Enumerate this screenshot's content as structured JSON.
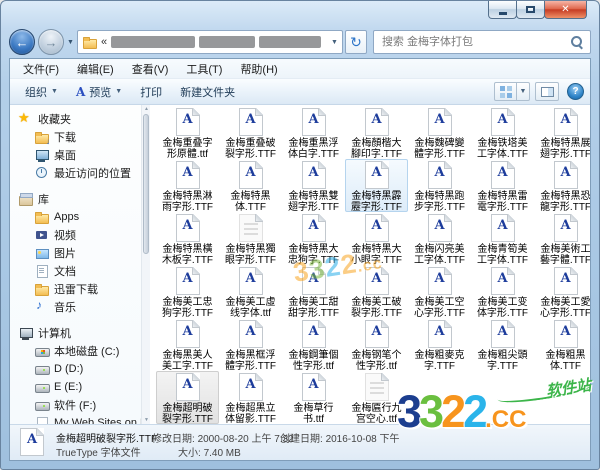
{
  "glyphs": {
    "back": "←",
    "forward": "→",
    "dropdown": "▼",
    "history_dropdown": "▼",
    "refresh": "↻",
    "address_chevron": "«",
    "close": "✕",
    "help": "?",
    "file_letter": "A",
    "scroll_up": "▲",
    "scroll_down": "▼"
  },
  "topbar": {
    "search_text": "搜索 金梅字体打包"
  },
  "menubar": {
    "items": [
      "文件(F)",
      "编辑(E)",
      "查看(V)",
      "工具(T)",
      "帮助(H)"
    ]
  },
  "command_bar": {
    "organize": "组织",
    "preview": "预览",
    "print": "打印",
    "new_folder": "新建文件夹"
  },
  "sidebar": {
    "sections": [
      {
        "label": "收藏夹",
        "icon": "star",
        "items": [
          {
            "label": "下载",
            "icon": "folderdl"
          },
          {
            "label": "桌面",
            "icon": "desktop"
          },
          {
            "label": "最近访问的位置",
            "icon": "recent"
          }
        ]
      },
      {
        "label": "库",
        "icon": "libs",
        "items": [
          {
            "label": "Apps",
            "icon": "folder"
          },
          {
            "label": "视频",
            "icon": "video"
          },
          {
            "label": "图片",
            "icon": "pic"
          },
          {
            "label": "文档",
            "icon": "doc"
          },
          {
            "label": "迅雷下载",
            "icon": "folder"
          },
          {
            "label": "音乐",
            "icon": "music"
          }
        ]
      },
      {
        "label": "计算机",
        "icon": "computer",
        "items": [
          {
            "label": "本地磁盘 (C:)",
            "icon": "drivec"
          },
          {
            "label": "D (D:)",
            "icon": "drive"
          },
          {
            "label": "E (E:)",
            "icon": "drive"
          },
          {
            "label": "软件 (F:)",
            "icon": "drive"
          },
          {
            "label": "My Web Sites on MSN",
            "icon": "page"
          }
        ]
      }
    ]
  },
  "files": [
    {
      "name": "金梅重叠字形原體.ttf",
      "lines": [
        "金梅重叠字",
        "形原體.ttf"
      ]
    },
    {
      "name": "金梅重叠破裂字形.TTF",
      "lines": [
        "金梅重叠破",
        "裂字形.TTF"
      ]
    },
    {
      "name": "金梅重黑浮体白字.TTF",
      "lines": [
        "金梅重黑浮",
        "体白字.TTF"
      ]
    },
    {
      "name": "金梅顏楷大腳印字.TTF",
      "lines": [
        "金梅顏楷大",
        "腳印字.TTF"
      ]
    },
    {
      "name": "金梅魏碑變體字形.TTF",
      "lines": [
        "金梅魏碑變",
        "體字形.TTF"
      ]
    },
    {
      "name": "金梅铁塔美工字体.TTF",
      "lines": [
        "金梅铁塔美",
        "工字体.TTF"
      ]
    },
    {
      "name": "金梅特黑展翅字形.TTF",
      "lines": [
        "金梅特黑展",
        "翅字形.TTF"
      ]
    },
    {
      "name": "金梅特黑淋雨字形.TTF",
      "lines": [
        "金梅特黑淋",
        "雨字形.TTF"
      ]
    },
    {
      "name": "金梅特黑体.TTF",
      "lines": [
        "金梅特黑",
        "体.TTF"
      ]
    },
    {
      "name": "金梅特黑雙翅字形.TTF",
      "lines": [
        "金梅特黑雙",
        "翅字形.TTF"
      ]
    },
    {
      "name": "金梅特黑霹靂字形.TTF",
      "lines": [
        "金梅特黑霹",
        "靂字形.TTF"
      ],
      "state": "hover"
    },
    {
      "name": "金梅特黑跑步字形.TTF",
      "lines": [
        "金梅特黑跑",
        "步字形.TTF"
      ]
    },
    {
      "name": "金梅特黑雷電字形.TTF",
      "lines": [
        "金梅特黑雷",
        "電字形.TTF"
      ]
    },
    {
      "name": "金梅特黑恐龍字形.TTF",
      "lines": [
        "金梅特黑恐",
        "龍字形.TTF"
      ]
    },
    {
      "name": "金梅特黑橫木板字.TTF",
      "lines": [
        "金梅特黑橫",
        "木板字.TTF"
      ]
    },
    {
      "name": "金梅特黑獨眼字形.TTF",
      "lines": [
        "金梅特黑獨",
        "眼字形.TTF"
      ],
      "ghost": true
    },
    {
      "name": "金梅特黑大忠狗字.TTF",
      "lines": [
        "金梅特黑大",
        "忠狗字.TTF"
      ]
    },
    {
      "name": "金梅特黑大小眼字.TTF",
      "lines": [
        "金梅特黑大",
        "小眼字.TTF"
      ]
    },
    {
      "name": "金梅闪亮美工字体.TTF",
      "lines": [
        "金梅闪亮美",
        "工字体.TTF"
      ]
    },
    {
      "name": "金梅青筍美工字体.TTF",
      "lines": [
        "金梅青筍美",
        "工字体.TTF"
      ]
    },
    {
      "name": "金梅美術工藝字體.TTF",
      "lines": [
        "金梅美術工",
        "藝字體.TTF"
      ]
    },
    {
      "name": "金梅美工忠狗字形.TTF",
      "lines": [
        "金梅美工忠",
        "狗字形.TTF"
      ]
    },
    {
      "name": "金梅美工虛线字体.ttf",
      "lines": [
        "金梅美工虛",
        "线字体.ttf"
      ]
    },
    {
      "name": "金梅美工甜甜字形.TTF",
      "lines": [
        "金梅美工甜",
        "甜字形.TTF"
      ]
    },
    {
      "name": "金梅美工破裂字形.TTF",
      "lines": [
        "金梅美工破",
        "裂字形.TTF"
      ]
    },
    {
      "name": "金梅美工空心字形.TTF",
      "lines": [
        "金梅美工空",
        "心字形.TTF"
      ]
    },
    {
      "name": "金梅美工变体字形.TTF",
      "lines": [
        "金梅美工变",
        "体字形.TTF"
      ]
    },
    {
      "name": "金梅美工愛心字形.TTF",
      "lines": [
        "金梅美工愛",
        "心字形.TTF"
      ]
    },
    {
      "name": "金梅黑美人美工字.TTF",
      "lines": [
        "金梅黑美人",
        "美工字.TTF"
      ]
    },
    {
      "name": "金梅黑框浮體字形.TTF",
      "lines": [
        "金梅黑框浮",
        "體字形.TTF"
      ]
    },
    {
      "name": "金梅鋼筆個性字形.ttf",
      "lines": [
        "金梅鋼筆個",
        "性字形.ttf"
      ]
    },
    {
      "name": "金梅钢笔个性字形.ttf",
      "lines": [
        "金梅钢笔个",
        "性字形.ttf"
      ]
    },
    {
      "name": "金梅粗麥克字.TTF",
      "lines": [
        "金梅粗麥克",
        "字.TTF"
      ]
    },
    {
      "name": "金梅粗尖頭字.TTF",
      "lines": [
        "金梅粗尖頭",
        "字.TTF"
      ]
    },
    {
      "name": "金梅粗黑体.TTF",
      "lines": [
        "金梅粗黑",
        "体.TTF"
      ]
    },
    {
      "name": "金梅超明破裂字形.TTF",
      "lines": [
        "金梅超明破",
        "裂字形.TTF"
      ],
      "state": "selected"
    },
    {
      "name": "金梅超黑立体留影.TTF",
      "lines": [
        "金梅超黑立",
        "体留影.TTF"
      ]
    },
    {
      "name": "金梅草行书.ttf",
      "lines": [
        "金梅草行",
        "书.ttf"
      ]
    },
    {
      "name": "金梅匾行九宫空心.ttf",
      "lines": [
        "金梅匾行九",
        "宫空心.ttf"
      ],
      "ghost": true
    }
  ],
  "details": {
    "name": "金梅超明破裂字形.TTF",
    "modified_label": "修改日期:",
    "modified": "2000-08-20 上午 7:32",
    "created_label": "创建日期:",
    "created": "2016-10-08 下午",
    "type": "TrueType 字体文件",
    "size_label": "大小:",
    "size": "7.40 MB"
  },
  "watermark": {
    "site": "软件站",
    "center_letters": [
      [
        "3",
        "#f9a623"
      ],
      [
        "3",
        "#7cb83d"
      ],
      [
        "2",
        "#2aaee8"
      ],
      [
        "2",
        "#f9a623"
      ]
    ],
    "center_cc": ".cc",
    "big_letters": [
      [
        "3",
        "#1c3e8f"
      ],
      [
        "3",
        "#6abf3f"
      ],
      [
        "2",
        "#f7941d"
      ],
      [
        "2",
        "#2bb4ea"
      ]
    ],
    "big_cc": ".CC",
    "big_cc_color": "#f7941d"
  }
}
